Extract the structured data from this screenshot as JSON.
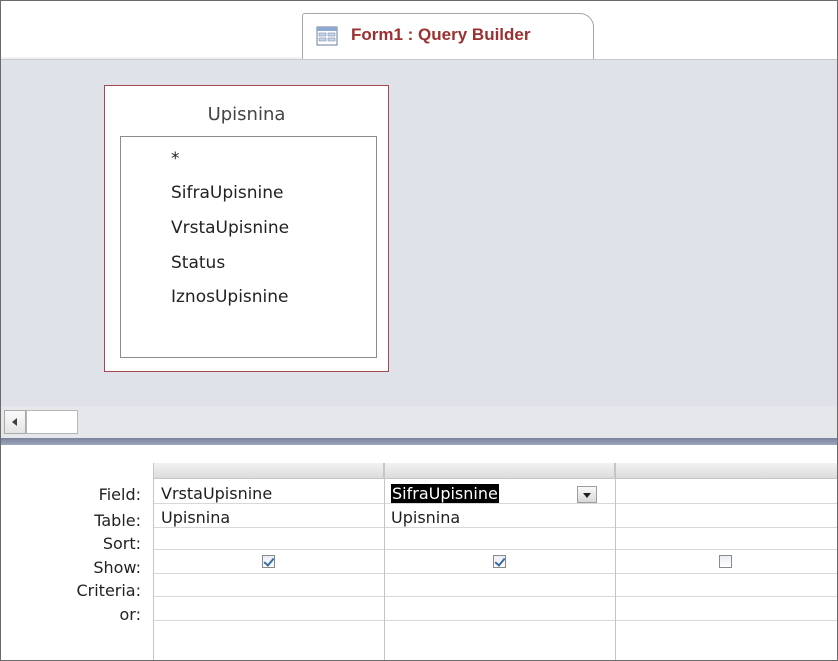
{
  "window": {
    "tab_title": "Form1 : Query Builder",
    "tab_icon": "query-form-icon"
  },
  "design_area": {
    "table": {
      "name": "Upisnina",
      "fields": [
        "*",
        "SifraUpisnine",
        "VrstaUpisnine",
        "Status",
        "IznosUpisnine"
      ]
    }
  },
  "grid": {
    "row_labels": [
      "Field:",
      "Table:",
      "Sort:",
      "Show:",
      "Criteria:",
      "or:"
    ],
    "columns": [
      {
        "field": "VrstaUpisnine",
        "table": "Upisnina",
        "sort": "",
        "show": true,
        "criteria": "",
        "or": "",
        "selected": false
      },
      {
        "field": "SifraUpisnine",
        "table": "Upisnina",
        "sort": "",
        "show": true,
        "criteria": "",
        "or": "",
        "selected": true
      },
      {
        "field": "",
        "table": "",
        "sort": "",
        "show": false,
        "criteria": "",
        "or": "",
        "selected": false
      }
    ]
  },
  "colors": {
    "tab_title": "#9c2f2f",
    "table_border": "#a84650",
    "design_background": "#dfe2e8",
    "splitter": "#8a92ab",
    "selection": "#000000"
  }
}
